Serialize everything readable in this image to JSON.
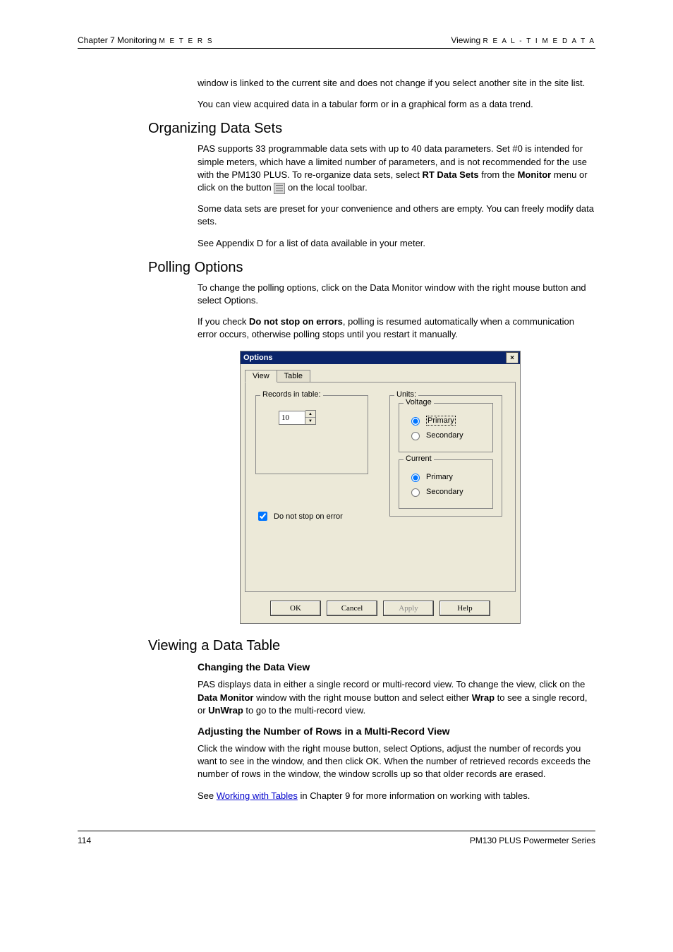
{
  "header": {
    "left_chapter": "Chapter 7 Monitoring",
    "left_meters": "M E T E R S",
    "right_viewing": "Viewing",
    "right_rtdata": "R E A L - T I M E  D A T A"
  },
  "intro": {
    "p1": "window is linked to the current site and does not change if you select another site in the site list.",
    "p2": "You can view acquired data in a tabular form or in a graphical form as a data trend."
  },
  "sec1": {
    "title": "Organizing Data Sets",
    "p1a": "PAS supports 33 programmable data sets with up to 40 data parameters. Set #0 is intended for simple meters, which have a limited number of parameters, and is not recommended for the use with the PM130 PLUS. To re-organize data sets, select ",
    "p1b_bold": "RT Data Sets",
    "p1c": " from the ",
    "p1d_bold": "Monitor",
    "p1e": " menu or click on the button ",
    "p1f": " on the local toolbar.",
    "p2": "Some data sets are preset for your convenience and others are empty. You can freely modify data sets.",
    "p3": "See Appendix D for a list of data available in your meter."
  },
  "sec2": {
    "title": "Polling Options",
    "p1": "To change the polling options, click on the Data Monitor window with the right mouse button and select Options.",
    "p2a": "If you check ",
    "p2b_bold": "Do not stop on errors",
    "p2c": ", polling is resumed automatically when a communication error occurs, otherwise polling stops until you restart it manually."
  },
  "dialog": {
    "title": "Options",
    "close": "×",
    "tabs": {
      "view": "View",
      "table": "Table"
    },
    "records_legend": "Records in table:",
    "records_value": "10",
    "checkbox_label": "Do not stop on error",
    "units_legend": "Units:",
    "voltage_legend": "Voltage",
    "current_legend": "Current",
    "primary": "Primary",
    "secondary": "Secondary",
    "buttons": {
      "ok": "OK",
      "cancel": "Cancel",
      "apply": "Apply",
      "help": "Help"
    }
  },
  "sec3": {
    "title": "Viewing a Data Table",
    "h1": "Changing the Data View",
    "p1a": "PAS displays data in either a single record or multi-record view. To change the view, click on the ",
    "p1b_bold": "Data Monitor",
    "p1c": " window with the right mouse button and select either ",
    "p1d_bold": "Wrap",
    "p1e": " to see a single record, or ",
    "p1f_bold": "UnWrap",
    "p1g": " to go to the multi-record view.",
    "h2": "Adjusting the Number of Rows in a Multi-Record View",
    "p2": "Click the window with the right mouse button, select Options, adjust the number of records you want to see in the window, and then click OK. When the number of retrieved records exceeds the number of rows in the window, the window scrolls up so that older records are erased.",
    "p3a": "See ",
    "p3b_link": "Working with Tables",
    "p3c": " in Chapter 9 for more information on working with tables."
  },
  "footer": {
    "page": "114",
    "right": "PM130 PLUS Powermeter Series"
  }
}
